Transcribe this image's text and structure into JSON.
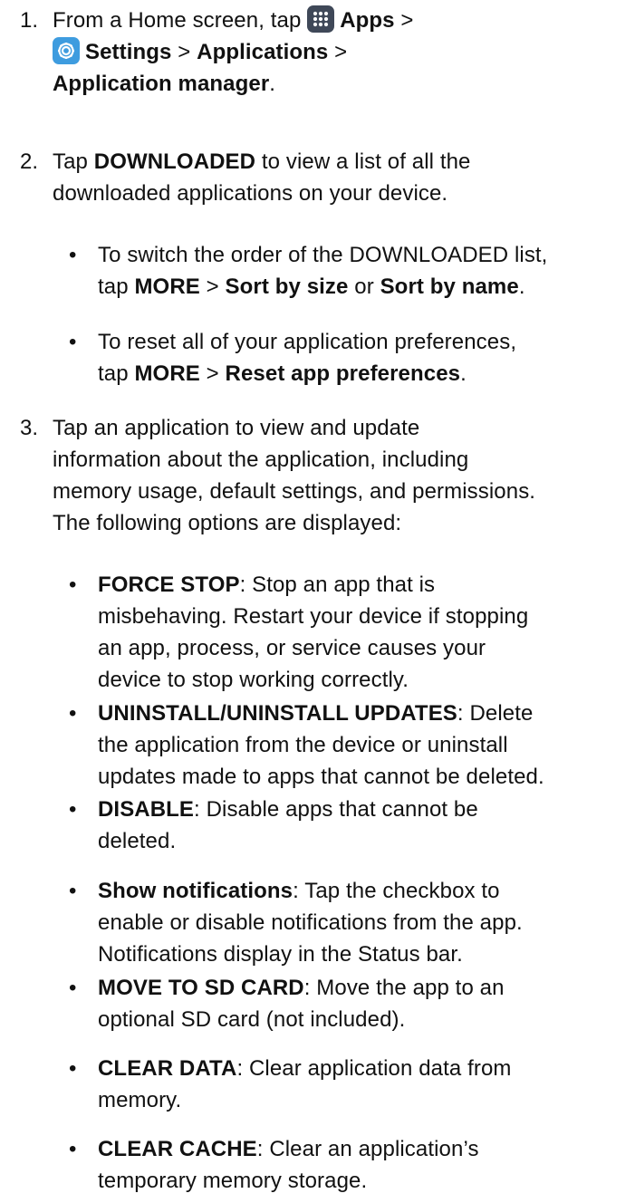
{
  "step1": {
    "number": "1.",
    "prefix": "From a Home screen, tap",
    "apps_icon": "apps-grid-icon",
    "apps": "Apps",
    "sep1": ">",
    "settings_icon": "settings-gear-icon",
    "settings": "Settings",
    "sep2": ">",
    "applications": "Applications",
    "sep3": ">",
    "app_manager": "Application manager",
    "period": "."
  },
  "step2": {
    "number": "2.",
    "prefix": "Tap",
    "downloaded": "DOWNLOADED",
    "line1_rest": "to view a list of all the",
    "line2": "downloaded applications on your device.",
    "bullets": [
      {
        "line1": "To switch the order of the DOWNLOADED list,",
        "tap": "tap",
        "more": "MORE",
        "sep": ">",
        "opt1": "Sort by size",
        "or": "or",
        "opt2": "Sort by name",
        "period": "."
      },
      {
        "line1": "To reset all of your application preferences,",
        "tap": "tap",
        "more": "MORE",
        "sep": ">",
        "opt1": "Reset app preferences",
        "period": "."
      }
    ]
  },
  "step3": {
    "number": "3.",
    "lines": [
      "Tap an application to view and update",
      "information about the application, including",
      "memory usage, default settings, and permissions.",
      "The following options are displayed:"
    ],
    "options": [
      {
        "term": "FORCE STOP",
        "lines": [
          ": Stop an app that is",
          "misbehaving. Restart your device if stopping",
          "an app, process, or service causes your",
          "device to stop working correctly."
        ]
      },
      {
        "term": "UNINSTALL/UNINSTALL UPDATES",
        "lines": [
          ": Delete",
          "the application from the device or uninstall",
          "updates made to apps that cannot be deleted."
        ]
      },
      {
        "term": "DISABLE",
        "lines": [
          ": Disable apps that cannot be",
          "deleted."
        ]
      },
      {
        "term": "Show notifications",
        "lines": [
          ": Tap the checkbox to",
          "enable or disable notifications from the app.",
          "Notifications display in the Status bar."
        ]
      },
      {
        "term": "MOVE TO SD CARD",
        "lines": [
          ": Move the app to an",
          "optional SD card (not included)."
        ]
      },
      {
        "term": "CLEAR DATA",
        "lines": [
          ": Clear application data from",
          "memory."
        ]
      },
      {
        "term": "CLEAR CACHE",
        "lines": [
          ": Clear an application’s",
          "temporary memory storage."
        ]
      }
    ]
  },
  "colors": {
    "text": "#111111",
    "apps_icon_bg": "#3f4858",
    "settings_icon_bg": "#3e9cdf"
  }
}
